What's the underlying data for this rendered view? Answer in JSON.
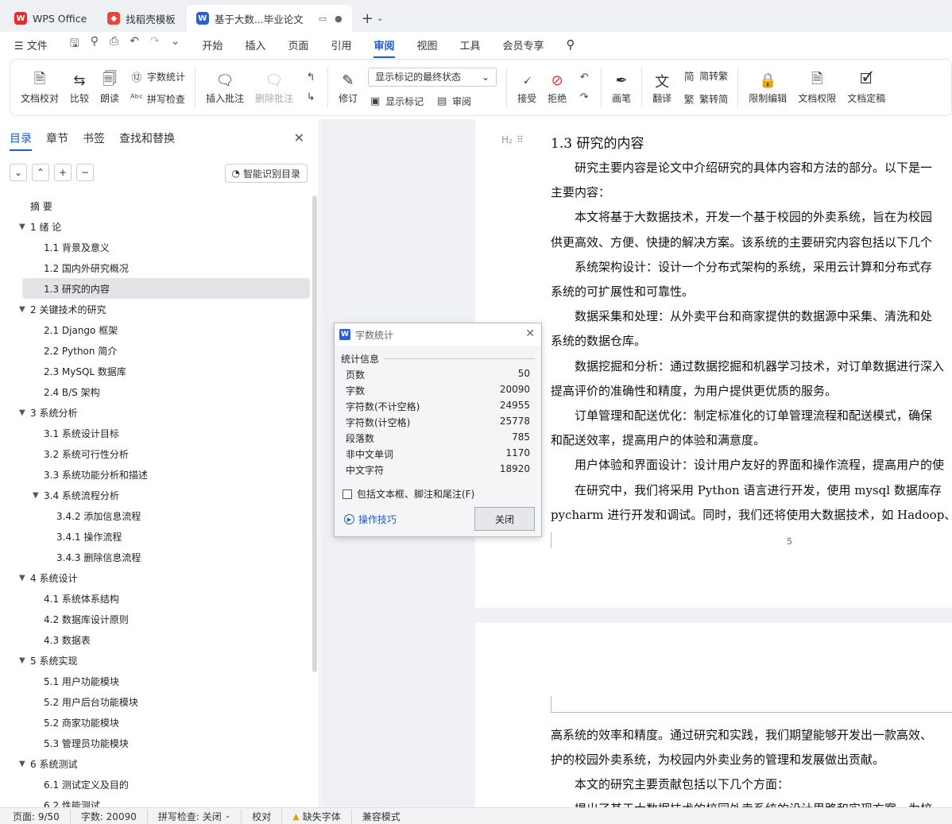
{
  "tabs": [
    {
      "label": "WPS Office",
      "icon": "wps-logo-icon"
    },
    {
      "label": "找稻壳模板",
      "icon": "docer-logo-icon"
    },
    {
      "label": "基于大数...毕业论文",
      "icon": "writer-logo-icon",
      "active": true
    }
  ],
  "menubar": {
    "file": "文件",
    "items": [
      "开始",
      "插入",
      "页面",
      "引用",
      "审阅",
      "视图",
      "工具",
      "会员专享"
    ],
    "active": "审阅"
  },
  "ribbon": {
    "doc_check": "文档校对",
    "compare": "比较",
    "read_aloud": "朗读",
    "word_count": "字数统计",
    "spell_check": "拼写检查",
    "insert_comment": "插入批注",
    "delete_comment": "删除批注",
    "track_changes": "修订",
    "markup_state": "显示标记的最终状态",
    "show_markup": "显示标记",
    "review_pane": "审阅",
    "accept": "接受",
    "reject": "拒绝",
    "pen": "画笔",
    "translate": "翻译",
    "to_traditional": "简转繁",
    "to_simplified": "繁转简",
    "restrict_edit": "限制编辑",
    "doc_permission": "文档权限",
    "doc_finalize": "文档定稿"
  },
  "leftpanel": {
    "tabs": [
      "目录",
      "章节",
      "书签",
      "查找和替换"
    ],
    "smart_toc": "智能识别目录",
    "toc": [
      {
        "label": "摘    要",
        "level": 0,
        "arrow": false
      },
      {
        "label": "1  绪  论",
        "level": 0,
        "arrow": true
      },
      {
        "label": "1.1 背景及意义",
        "level": 1
      },
      {
        "label": "1.2 国内外研究概况",
        "level": 1
      },
      {
        "label": "1.3 研究的内容",
        "level": 1,
        "selected": true
      },
      {
        "label": "2  关键技术的研究",
        "level": 0,
        "arrow": true
      },
      {
        "label": "2.1 Django 框架",
        "level": 1
      },
      {
        "label": "2.2 Python 简介",
        "level": 1
      },
      {
        "label": "2.3 MySQL 数据库",
        "level": 1
      },
      {
        "label": "2.4 B/S 架构",
        "level": 1
      },
      {
        "label": "3  系统分析",
        "level": 0,
        "arrow": true
      },
      {
        "label": "3.1  系统设计目标",
        "level": 1
      },
      {
        "label": "3.2  系统可行性分析",
        "level": 1
      },
      {
        "label": "3.3  系统功能分析和描述",
        "level": 1
      },
      {
        "label": "3.4 系统流程分析",
        "level": 1,
        "arrow": true
      },
      {
        "label": "3.4.2 添加信息流程",
        "level": 2
      },
      {
        "label": "3.4.1 操作流程",
        "level": 2
      },
      {
        "label": "3.4.3 删除信息流程",
        "level": 2
      },
      {
        "label": "4  系统设计",
        "level": 0,
        "arrow": true
      },
      {
        "label": "4.1  系统体系结构",
        "level": 1
      },
      {
        "label": "4.2  数据库设计原则",
        "level": 1
      },
      {
        "label": "4.3  数据表",
        "level": 1
      },
      {
        "label": "5  系统实现",
        "level": 0,
        "arrow": true
      },
      {
        "label": "5.1 用户功能模块",
        "level": 1
      },
      {
        "label": "5.2 用户后台功能模块",
        "level": 1
      },
      {
        "label": "5.2 商家功能模块",
        "level": 1
      },
      {
        "label": "5.3 管理员功能模块",
        "level": 1
      },
      {
        "label": "6  系统测试",
        "level": 0,
        "arrow": true
      },
      {
        "label": "6.1 测试定义及目的",
        "level": 1
      },
      {
        "label": "6.2 性能测试",
        "level": 1
      }
    ]
  },
  "document": {
    "heading_marker": "H₂",
    "heading": "1.3 研究的内容",
    "page1_lines": [
      "　　研究主要内容是论文中介绍研究的具体内容和方法的部分。以下是一",
      "主要内容：",
      "　　本文将基于大数据技术，开发一个基于校园的外卖系统，旨在为校园",
      "供更高效、方便、快捷的解决方案。该系统的主要研究内容包括以下几个",
      "　　系统架构设计：设计一个分布式架构的系统，采用云计算和分布式存",
      "系统的可扩展性和可靠性。",
      "　　数据采集和处理：从外卖平台和商家提供的数据源中采集、清洗和处",
      "系统的数据仓库。",
      "　　数据挖掘和分析：通过数据挖掘和机器学习技术，对订单数据进行深入",
      "提高评价的准确性和精度，为用户提供更优质的服务。",
      "　　订单管理和配送优化：制定标准化的订单管理流程和配送模式，确保",
      "和配送效率，提高用户的体验和满意度。",
      "　　用户体验和界面设计：设计用户友好的界面和操作流程，提高用户的使",
      "　　在研究中，我们将采用 Python 语言进行开发，使用 mysql 数据库存",
      "pycharm 进行开发和调试。同时，我们还将使用大数据技术，如 Hadoop、"
    ],
    "page_number": "5",
    "page2_lines": [
      "高系统的效率和精度。通过研究和实践，我们期望能够开发出一款高效、",
      "护的校园外卖系统，为校园内外卖业务的管理和发展做出贡献。",
      "　　本文的研究主要贡献包括以下几个方面：",
      "　　提出了基于大数据技术的校园外卖系统的设计思路和实现方案，为校"
    ]
  },
  "dialog": {
    "title": "字数统计",
    "section": "统计信息",
    "stats": [
      {
        "label": "页数",
        "value": "50"
      },
      {
        "label": "字数",
        "value": "20090"
      },
      {
        "label": "字符数(不计空格)",
        "value": "24955"
      },
      {
        "label": "字符数(计空格)",
        "value": "25778"
      },
      {
        "label": "段落数",
        "value": "785"
      },
      {
        "label": "非中文单词",
        "value": "1170"
      },
      {
        "label": "中文字符",
        "value": "18920"
      }
    ],
    "checkbox_label": "包括文本框、脚注和尾注(F)",
    "tips": "操作技巧",
    "close": "关闭"
  },
  "statusbar": {
    "page": "页面: 9/50",
    "words": "字数: 20090",
    "spell": "拼写检查: 关闭",
    "proof": "校对",
    "missing_font": "缺失字体",
    "compat": "兼容模式"
  }
}
